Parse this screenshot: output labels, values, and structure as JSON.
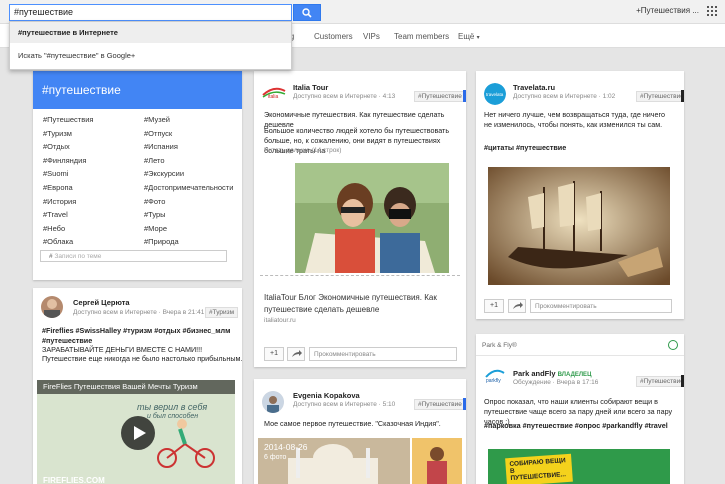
{
  "search": {
    "value": "#путешествие"
  },
  "dropdown": {
    "item1": "#путешествие в Интернете",
    "item2": "Искать \"#путешествие\" в Google+"
  },
  "header": {
    "user": "+Путешествия ..."
  },
  "nav": {
    "partial": "ig",
    "customers": "Customers",
    "vips": "VIPs",
    "team": "Team members",
    "more": "Ещё"
  },
  "hashtag_card": {
    "title": "#путешествие",
    "tags_left": [
      "#Путешествия",
      "#Туризм",
      "#Отдых",
      "#Финляндия",
      "#Suomi",
      "#Европа",
      "#История",
      "#Travel",
      "#Небо",
      "#Облака"
    ],
    "tags_right": [
      "#Музей",
      "#Отпуск",
      "#Испания",
      "#Лето",
      "#Экскурсии",
      "#Достопримечательности",
      "#Фото",
      "#Туры",
      "#Море",
      "#Природа"
    ],
    "search_placeholder": "Записи по теме"
  },
  "post_sergey": {
    "author": "Сергей Церюта",
    "meta": "Доступно всем в Интернете · Вчера в 21:41",
    "badge": "#Туризм",
    "hashtags": "#Fireflies #SwissHalley #туризм #отдых #бизнес_млм #путешествие",
    "line1": "ЗАРАБАТЫВАЙТЕ ДЕНЬГИ ВМЕСТЕ С НАМИ!!!",
    "line2": "Путешествие еще никогда не было настолько прибыльным. Мы",
    "video_title": "FireFlies Путешествия Вашей Мечты Туризм",
    "video_overlay": "ты верил в себя",
    "video_overlay2": "и был способен",
    "video_footer": "FIREFLIES.COM"
  },
  "post_italia": {
    "logo": "italia",
    "author": "Italia Tour",
    "meta": "Доступно всем в Интернете · 4:13",
    "badge": "#Путешествие",
    "line1": "Экономичные путешествия. Как путешествие сделать дешевле",
    "line2": "Большое количество людей хотело бы путешествовать больше, но, к сожалению, они видят в путешествиях большие траты на",
    "read_more": "Читать дальше (14 строк)",
    "link_title": "ItaliaTour Блог Экономичные путешествия. Как путешествие сделать дешевле",
    "link_domain": "italiatour.ru",
    "plus": "+1",
    "comment_placeholder": "Прокомментировать"
  },
  "post_evgenia": {
    "author": "Evgenia Kopakova",
    "meta": "Доступно всем в Интернете · 5:10",
    "badge": "#Путешествие",
    "line1": "Мое самое первое путешествие. \"Сказочная Индия\".",
    "album_date": "2014-08-26",
    "album_count": "6 фото"
  },
  "post_travelata": {
    "logo": "travelata",
    "author": "Travelata.ru",
    "meta": "Доступно всем в Интернете · 1:02",
    "badge": "#Путешествие",
    "line1": "Нет ничего лучше, чем возвращаться туда, где ничего не изменилось, чтобы понять, как изменился ты сам.",
    "hashtags": "#цитаты #путешествие",
    "plus": "+1",
    "comment_placeholder": "Прокомментировать"
  },
  "post_parkfly": {
    "section": "Park & Fly®",
    "logo": "parkfly",
    "author": "Park andFly",
    "role": "ВЛАДЕЛЕЦ",
    "meta": "Обсуждение · Вчера в 17:16",
    "badge": "#Путешествие",
    "line1": "Опрос показал, что наши клиенты собирают вещи в путешествие чаще всего за пару дней или всего за пару часов :)",
    "hashtags": "#парковка #путешествие #опрос #parkandfly #travel",
    "banner1": "СОБИРАЮ ВЕЩИ",
    "banner2": "В ПУТЕШЕСТВИЕ..."
  },
  "colors": {
    "accent": "#4285f4",
    "card_bg": "#ffffff",
    "page_bg": "#e5e5e5",
    "banner_green": "#2f9a4a"
  }
}
